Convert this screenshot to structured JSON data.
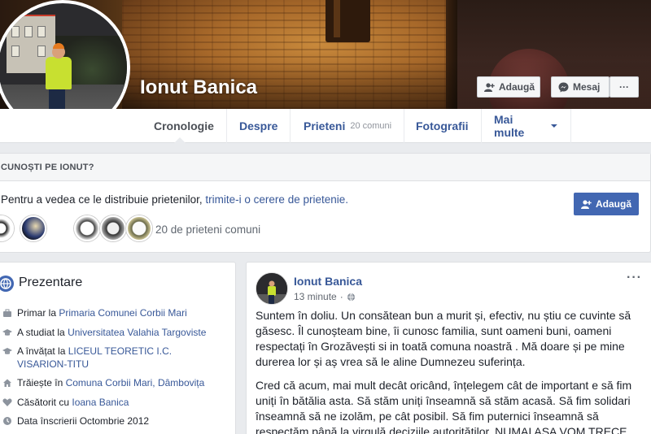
{
  "profile": {
    "name": "Ionut Banica",
    "add_button": "Adaugă",
    "message_button": "Mesaj",
    "more_button": "···"
  },
  "tabs": [
    {
      "label": "Cronologie",
      "active": true
    },
    {
      "label": "Despre"
    },
    {
      "label": "Prieteni",
      "sub": "20 comuni"
    },
    {
      "label": "Fotografii"
    },
    {
      "label": "Mai multe"
    }
  ],
  "know": {
    "heading": "CUNOȘTI PE IONUT?",
    "text_pre": "Pentru a vedea ce le distribuie prietenilor,",
    "text_link": "trimite-i o cerere de prietenie.",
    "add_button": "Adaugă",
    "mutual_label": "20 de prieteni comuni"
  },
  "intro": {
    "title": "Prezentare",
    "items": [
      {
        "pre": "Primar la",
        "link": "Primaria Comunei Corbii Mari",
        "icon": "briefcase-icon"
      },
      {
        "pre": "A studiat la",
        "link": "Universitatea Valahia Targoviste",
        "icon": "graduation-cap-icon"
      },
      {
        "pre": "A învățat la",
        "link": "LICEUL TEORETIC I.C. VISARION-TITU",
        "icon": "graduation-cap-icon"
      },
      {
        "pre": "Trăiește în",
        "link": "Comuna Corbii Mari, Dâmbovița",
        "icon": "home-icon"
      },
      {
        "pre": "Căsătorit cu",
        "link": "Ioana Banica",
        "icon": "heart-icon"
      },
      {
        "pre": "Data înscrierii Octombrie 2012",
        "link": "",
        "icon": "clock-icon"
      }
    ]
  },
  "post": {
    "author": "Ionut Banica",
    "time": "13 minute",
    "more": "···",
    "paragraphs": [
      "Suntem în doliu. Un consătean bun a murit și, efectiv, nu știu ce cuvinte să găsesc. Îl cunoșteam bine, îi cunosc familia, sunt oameni buni, oameni respectați în Grozăvești si in toată comuna noastră . Mă doare și pe mine durerea lor și aș vrea să le aline Dumnezeu suferința.",
      "Cred că acum, mai mult decât oricând, înțelegem cât de important e să fim uniți în bătălia asta. Să stăm uniți înseamnă să stăm acasă. Să fim solidari înseamnă să ne izolăm, pe cât posibil. Să fim puternici înseamnă să respectăm până la virgulă deciziile autorităților. NUMAI AȘA VOM TRECE"
    ]
  },
  "colors": {
    "brand": "#4267b2",
    "link": "#385898",
    "background": "#e9ebee"
  }
}
